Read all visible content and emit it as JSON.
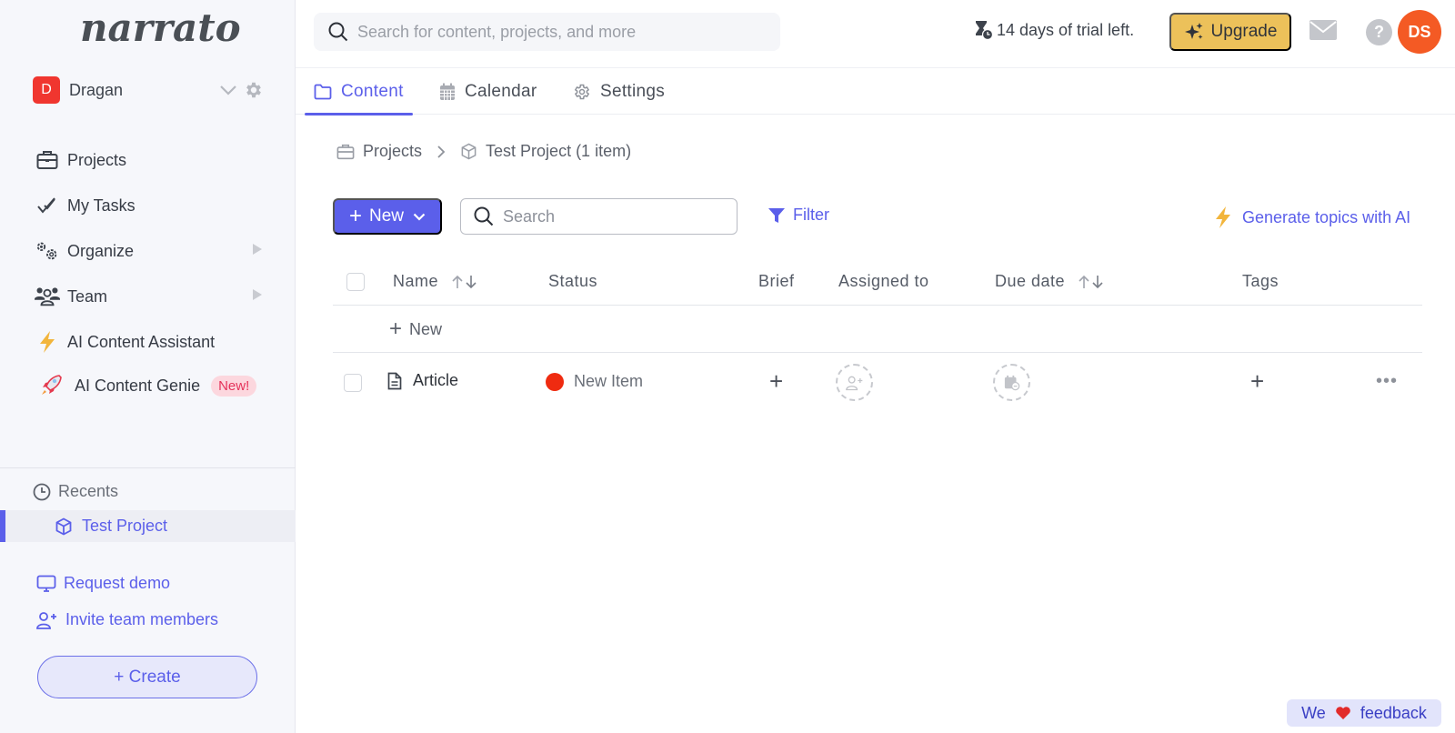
{
  "brand": {
    "logo_text": "narrato"
  },
  "workspace": {
    "initial": "D",
    "name": "Dragan"
  },
  "sidebar": {
    "items": [
      {
        "label": "Projects",
        "icon": "briefcase-icon",
        "has_submenu": false
      },
      {
        "label": "My Tasks",
        "icon": "double-check-icon",
        "has_submenu": false
      },
      {
        "label": "Organize",
        "icon": "gears-icon",
        "has_submenu": true
      },
      {
        "label": "Team",
        "icon": "users-icon",
        "has_submenu": true
      },
      {
        "label": "AI Content Assistant",
        "icon": "lightning-icon",
        "has_submenu": false
      },
      {
        "label": "AI Content Genie",
        "icon": "rocket-icon",
        "has_submenu": false,
        "badge": "New!"
      }
    ],
    "recents_label": "Recents",
    "recent_items": [
      {
        "label": "Test Project",
        "icon": "cube-icon",
        "active": true
      }
    ],
    "links": [
      {
        "label": "Request demo",
        "icon": "monitor-icon"
      },
      {
        "label": "Invite team members",
        "icon": "user-plus-icon"
      }
    ],
    "create_label": "+ Create"
  },
  "topbar": {
    "search_placeholder": "Search for content, projects, and more",
    "trial_text": "14 days of trial left.",
    "upgrade_label": "Upgrade",
    "help_symbol": "?",
    "user_initials": "DS"
  },
  "tabs": [
    {
      "label": "Content",
      "icon": "folder-icon",
      "active": true
    },
    {
      "label": "Calendar",
      "icon": "calendar-icon",
      "active": false
    },
    {
      "label": "Settings",
      "icon": "gear-icon",
      "active": false
    }
  ],
  "breadcrumb": {
    "root": "Projects",
    "current": "Test Project (1 item)"
  },
  "toolbar": {
    "new_label": "New",
    "search_placeholder": "Search",
    "filter_label": "Filter",
    "generate_label": "Generate topics with AI"
  },
  "table": {
    "columns": [
      "Name",
      "Status",
      "Brief",
      "Assigned to",
      "Due date",
      "Tags"
    ],
    "new_row_label": "New",
    "rows": [
      {
        "name": "Article",
        "status": "New Item",
        "status_color": "#ef2b10",
        "brief": "+",
        "tags": "+",
        "more": "•••"
      }
    ]
  },
  "colors": {
    "accent": "#5b5fea",
    "upgrade": "#ecc15a",
    "avatar": "#f45a24",
    "workspace": "#f0362f"
  },
  "feedback": {
    "before": "We",
    "after": "feedback"
  }
}
